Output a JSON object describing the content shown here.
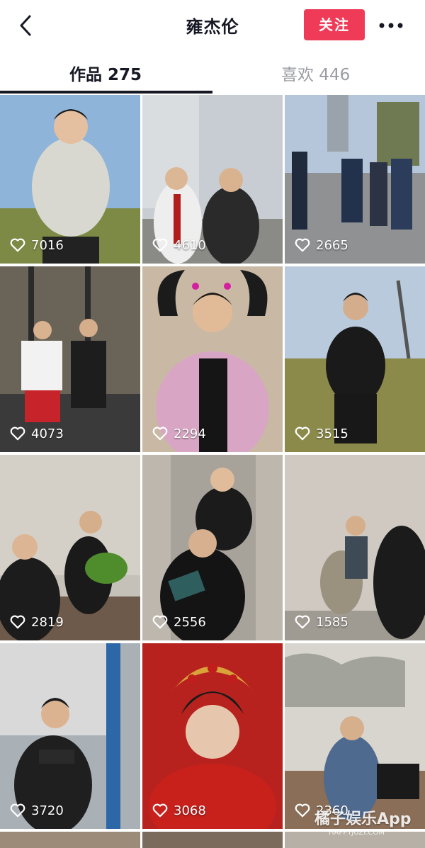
{
  "header": {
    "title": "雍杰伦",
    "follow_label": "关注"
  },
  "tabs": [
    {
      "label": "作品 275"
    },
    {
      "label": "喜欢 446"
    }
  ],
  "videos": [
    {
      "likes": "7016"
    },
    {
      "likes": "4610"
    },
    {
      "likes": "2665"
    },
    {
      "likes": "4073"
    },
    {
      "likes": "2294"
    },
    {
      "likes": "3515"
    },
    {
      "likes": "2819"
    },
    {
      "likes": "2556"
    },
    {
      "likes": "1585"
    },
    {
      "likes": "3720"
    },
    {
      "likes": "3068"
    },
    {
      "likes": "2360"
    }
  ],
  "watermark": {
    "brand": "橘子娱乐App",
    "url": "HAPPYJUZI.COM"
  },
  "colors": {
    "accent": "#ef3b57",
    "text": "#161823",
    "muted": "#9b9ca3"
  }
}
